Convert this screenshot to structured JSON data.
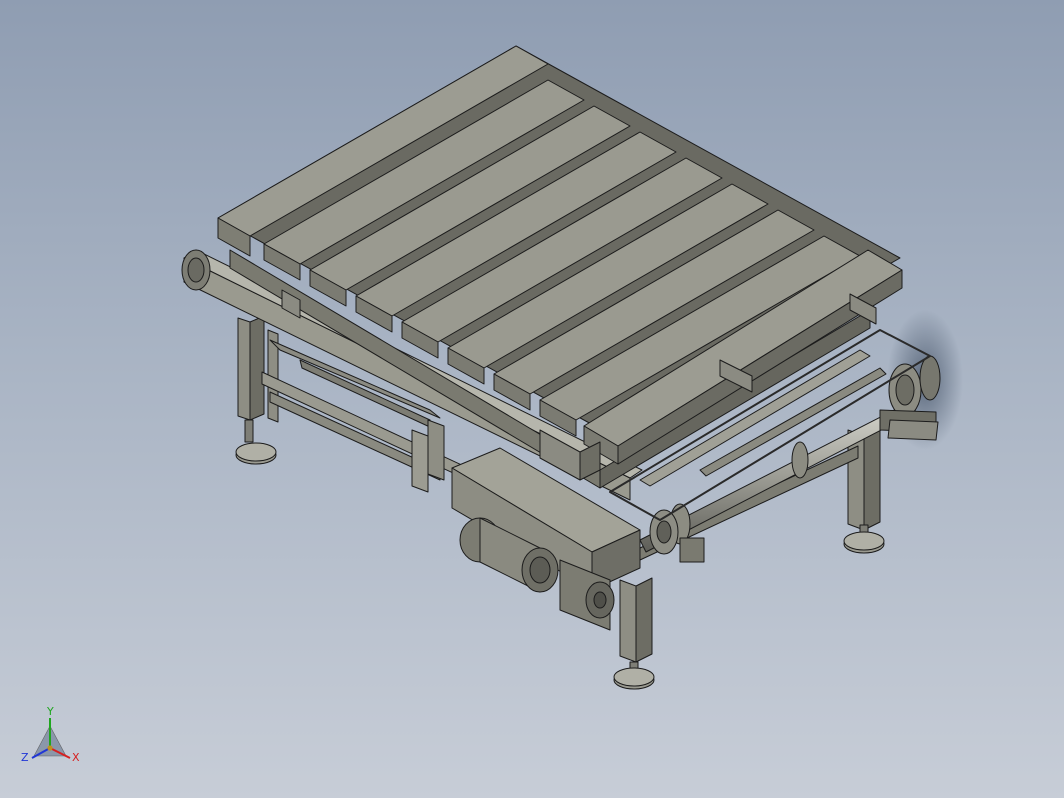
{
  "triad": {
    "x_label": "X",
    "y_label": "Y",
    "z_label": "Z",
    "x_color": "#d62020",
    "y_color": "#1fa61f",
    "z_color": "#2036d6"
  },
  "model": {
    "body_color": "#86867c",
    "edge_color": "#1c1c1c",
    "shadow_color": "#5f6f85"
  }
}
